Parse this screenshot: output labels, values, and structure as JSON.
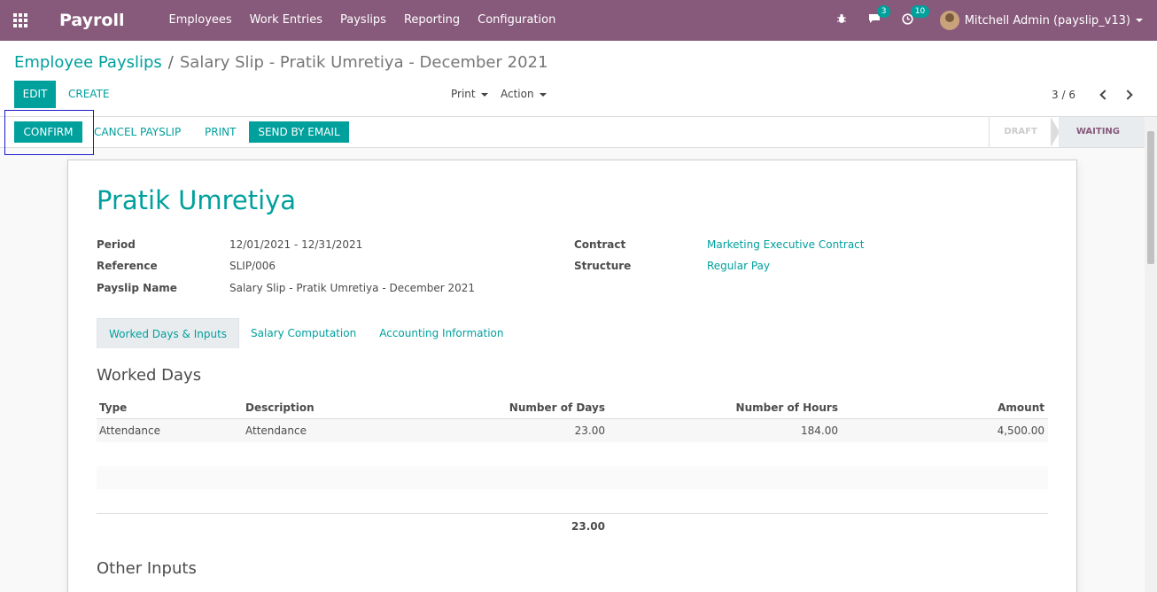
{
  "navbar": {
    "brand": "Payroll",
    "menu": [
      "Employees",
      "Work Entries",
      "Payslips",
      "Reporting",
      "Configuration"
    ],
    "messages_count": "3",
    "activities_count": "10",
    "user": "Mitchell Admin (payslip_v13)"
  },
  "breadcrumb": {
    "parent": "Employee Payslips",
    "separator": "/",
    "current": "Salary Slip - Pratik Umretiya - December 2021"
  },
  "control": {
    "edit": "EDIT",
    "create": "CREATE",
    "print": "Print",
    "action": "Action",
    "pager": "3 / 6"
  },
  "statusbar": {
    "confirm": "CONFIRM",
    "cancel": "CANCEL PAYSLIP",
    "print": "PRINT",
    "send_email": "SEND BY EMAIL",
    "stages": [
      "DRAFT",
      "WAITING"
    ],
    "active_stage": "WAITING"
  },
  "form": {
    "employee": "Pratik Umretiya",
    "period_label": "Period",
    "period": "12/01/2021 - 12/31/2021",
    "reference_label": "Reference",
    "reference": "SLIP/006",
    "payslip_name_label": "Payslip Name",
    "payslip_name": "Salary Slip - Pratik Umretiya - December 2021",
    "contract_label": "Contract",
    "contract": "Marketing Executive Contract",
    "structure_label": "Structure",
    "structure": "Regular Pay"
  },
  "tabs": [
    "Worked Days & Inputs",
    "Salary Computation",
    "Accounting Information"
  ],
  "worked_days": {
    "title": "Worked Days",
    "columns": [
      "Type",
      "Description",
      "Number of Days",
      "Number of Hours",
      "Amount"
    ],
    "rows": [
      {
        "type": "Attendance",
        "description": "Attendance",
        "days": "23.00",
        "hours": "184.00",
        "amount": "4,500.00"
      }
    ],
    "total_days": "23.00"
  },
  "other_inputs": {
    "title": "Other Inputs"
  },
  "colors": {
    "navbar": "#875a7b",
    "primary": "#00a09d"
  }
}
